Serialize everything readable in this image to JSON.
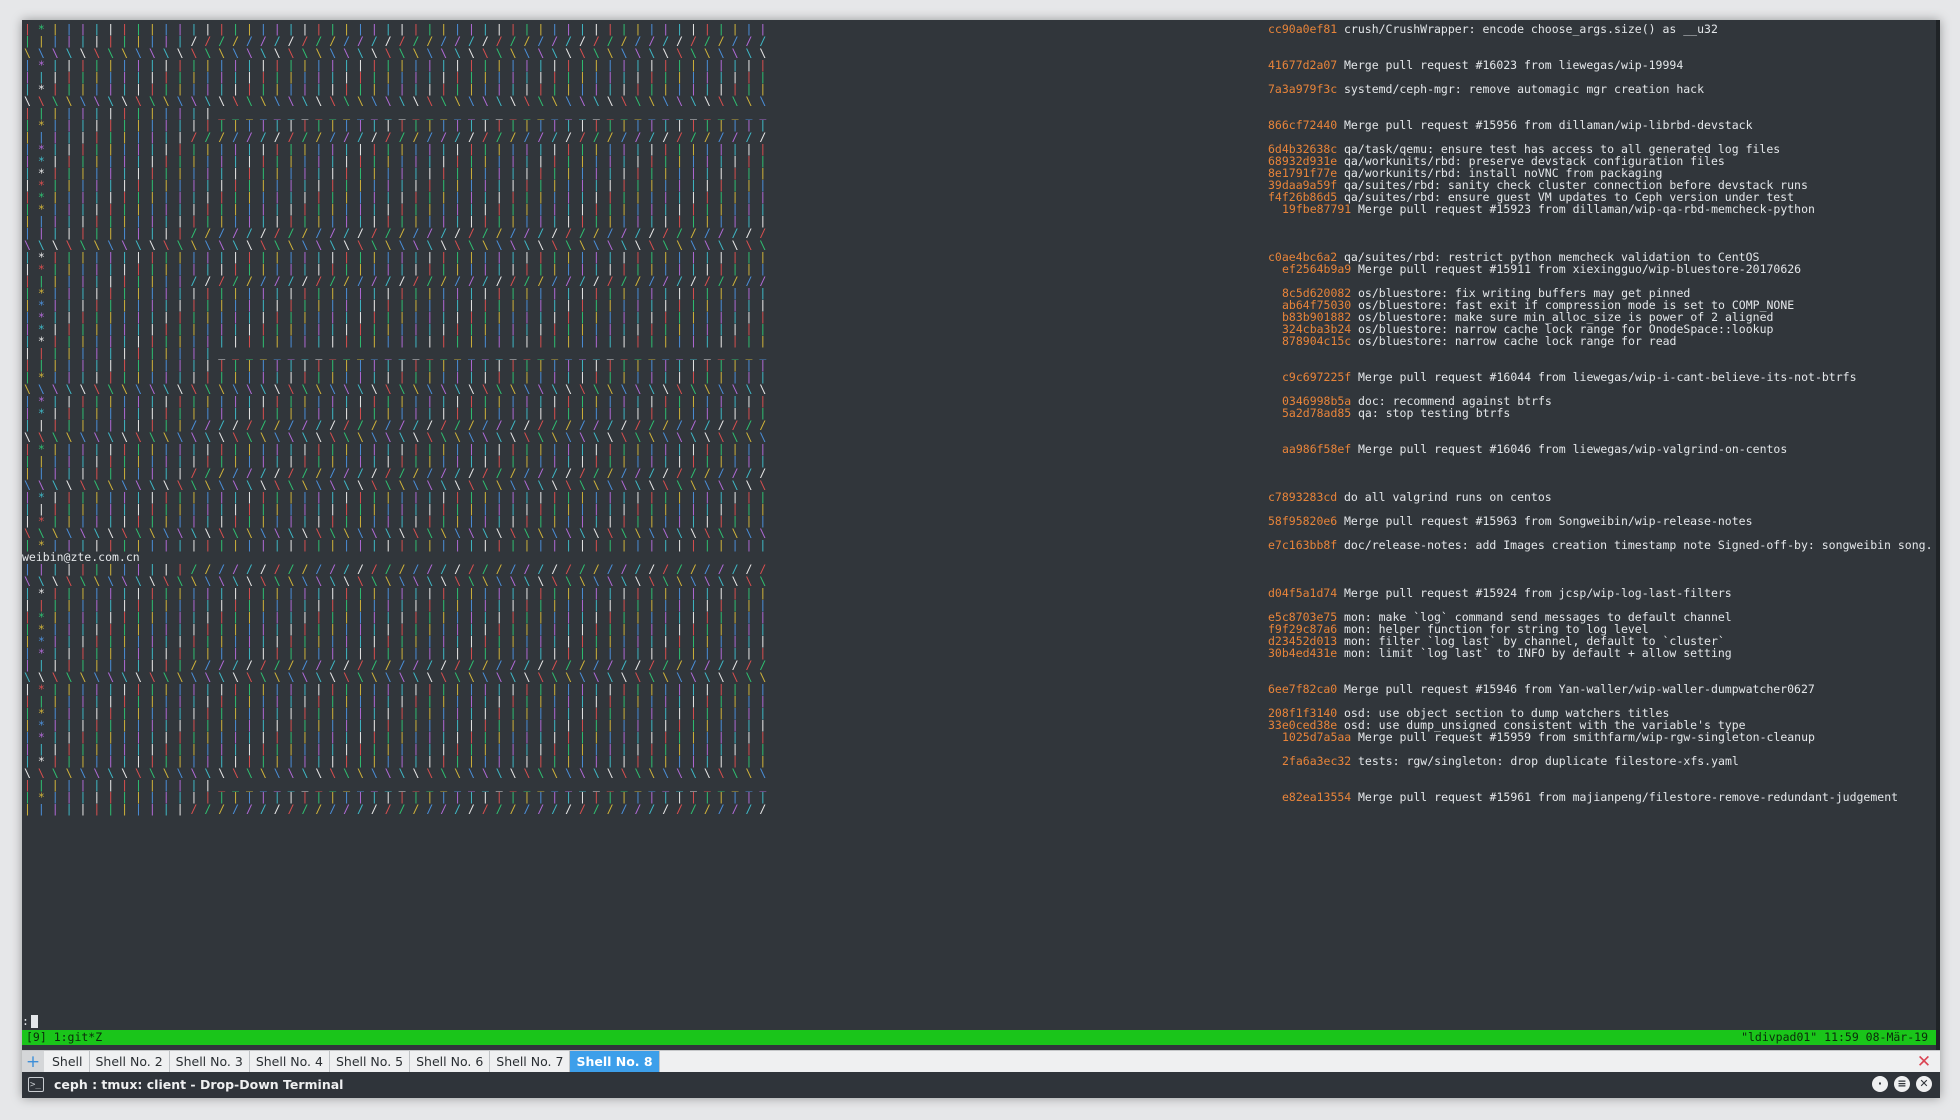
{
  "terminal": {
    "commits": [
      {
        "row": 0,
        "hash": "cc90a0ef81",
        "msg": "crush/CrushWrapper: encode choose_args.size() as __u32"
      },
      {
        "row": 3,
        "hash": "41677d2a07",
        "msg": "Merge pull request #16023 from liewegas/wip-19994"
      },
      {
        "row": 5,
        "hash": "7a3a979f3c",
        "msg": "systemd/ceph-mgr: remove automagic mgr creation hack"
      },
      {
        "row": 8,
        "hash": "866cf72440",
        "msg": "Merge pull request #15956 from dillaman/wip-librbd-devstack"
      },
      {
        "row": 10,
        "hash": "6d4b32638c",
        "msg": "qa/task/qemu: ensure test has access to all generated log files"
      },
      {
        "row": 11,
        "hash": "68932d931e",
        "msg": "qa/workunits/rbd: preserve devstack configuration files"
      },
      {
        "row": 12,
        "hash": "8e1791f77e",
        "msg": "qa/workunits/rbd: install noVNC from packaging"
      },
      {
        "row": 13,
        "hash": "39daa9a59f",
        "msg": "qa/suites/rbd: sanity check cluster connection before devstack runs"
      },
      {
        "row": 14,
        "hash": "f4f26b86d5",
        "msg": "qa/suites/rbd: ensure guest VM updates to Ceph version under test"
      },
      {
        "row": 15,
        "hash": "19fbe87791",
        "msg": "Merge pull request #15923 from dillaman/wip-qa-rbd-memcheck-python",
        "indent": true
      },
      {
        "row": 19,
        "hash": "c0ae4bc6a2",
        "msg": "qa/suites/rbd: restrict python memcheck validation to CentOS"
      },
      {
        "row": 20,
        "hash": "ef2564b9a9",
        "msg": "Merge pull request #15911 from xiexingguo/wip-bluestore-20170626",
        "indent": true
      },
      {
        "row": 22,
        "hash": "8c5d620082",
        "msg": "os/bluestore: fix writing buffers may get pinned",
        "indent": true
      },
      {
        "row": 23,
        "hash": "ab64f75030",
        "msg": "os/bluestore: fast exit if compression mode is set to COMP_NONE",
        "indent": true
      },
      {
        "row": 24,
        "hash": "b83b901882",
        "msg": "os/bluestore: make sure min_alloc_size is power of 2 aligned",
        "indent": true
      },
      {
        "row": 25,
        "hash": "324cba3b24",
        "msg": "os/bluestore: narrow cache lock range for OnodeSpace::lookup",
        "indent": true
      },
      {
        "row": 26,
        "hash": "878904c15c",
        "msg": "os/bluestore: narrow cache lock range for read",
        "indent": true
      },
      {
        "row": 29,
        "hash": "c9c697225f",
        "msg": "Merge pull request #16044 from liewegas/wip-i-cant-believe-its-not-btrfs",
        "indent": true
      },
      {
        "row": 31,
        "hash": "0346998b5a",
        "msg": "doc: recommend against btrfs",
        "indent": true
      },
      {
        "row": 32,
        "hash": "5a2d78ad85",
        "msg": "qa: stop testing btrfs",
        "indent": true
      },
      {
        "row": 35,
        "hash": "aa986f58ef",
        "msg": "Merge pull request #16046 from liewegas/wip-valgrind-on-centos",
        "indent": true
      },
      {
        "row": 39,
        "hash": "c7893283cd",
        "msg": "do all valgrind runs on centos"
      },
      {
        "row": 41,
        "hash": "58f95820e6",
        "msg": "Merge pull request #15963 from Songweibin/wip-release-notes"
      },
      {
        "row": 43,
        "hash": "e7c163bb8f",
        "msg": "doc/release-notes: add Images creation timestamp note Signed-off-by: songweibin song."
      },
      {
        "row": 47,
        "hash": "d04f5a1d74",
        "msg": "Merge pull request #15924 from jcsp/wip-log-last-filters"
      },
      {
        "row": 49,
        "hash": "e5c8703e75",
        "msg": "mon: make `log` command send messages to default channel"
      },
      {
        "row": 50,
        "hash": "f9f29c87a6",
        "msg": "mon: helper function for string to log level"
      },
      {
        "row": 51,
        "hash": "d23452d013",
        "msg": "mon: filter `log last` by channel, default to `cluster`"
      },
      {
        "row": 52,
        "hash": "30b4ed431e",
        "msg": "mon: limit `log last` to INFO by default + allow setting"
      },
      {
        "row": 55,
        "hash": "6ee7f82ca0",
        "msg": "Merge pull request #15946 from Yan-waller/wip-waller-dumpwatcher0627"
      },
      {
        "row": 57,
        "hash": "208f1f3140",
        "msg": "osd: use object section to dump watchers titles"
      },
      {
        "row": 58,
        "hash": "33e0ced38e",
        "msg": "osd: use dump_unsigned consistent with the variable's type"
      },
      {
        "row": 59,
        "hash": "1025d7a5aa",
        "msg": "Merge pull request #15959 from smithfarm/wip-rgw-singleton-cleanup",
        "indent": true
      },
      {
        "row": 61,
        "hash": "2fa6a3ec32",
        "msg": "tests: rgw/singleton: drop duplicate filestore-xfs.yaml",
        "indent": true
      },
      {
        "row": 64,
        "hash": "e82ea13554",
        "msg": "Merge pull request #15961 from majianpeng/filestore-remove-redundant-judgement",
        "indent": true
      }
    ],
    "wrap_row": 44,
    "wrap_text": "weibin@zte.com.cn",
    "prompt_text": ":",
    "status_left": "[9] 1:git*Z",
    "status_right": "\"ldivpad01\" 11:59 08-Mär-19"
  },
  "tabbar": {
    "new_tab_label": "+",
    "tabs": [
      {
        "label": "Shell",
        "active": false
      },
      {
        "label": "Shell No. 2",
        "active": false
      },
      {
        "label": "Shell No. 3",
        "active": false
      },
      {
        "label": "Shell No. 4",
        "active": false
      },
      {
        "label": "Shell No. 5",
        "active": false
      },
      {
        "label": "Shell No. 6",
        "active": false
      },
      {
        "label": "Shell No. 7",
        "active": false
      },
      {
        "label": "Shell No. 8",
        "active": true
      }
    ],
    "close_label": "✕"
  },
  "window": {
    "title": "ceph : tmux: client - Drop-Down Terminal",
    "icon_label": ">_",
    "btn_min": "·",
    "btn_menu": "≡",
    "btn_close": "✕"
  },
  "colors": {
    "terminal_bg": "#31363b",
    "hash_color": "#e8843a",
    "status_bg": "#1ac51a",
    "active_tab": "#3d9fea",
    "close_red": "#da4453"
  }
}
